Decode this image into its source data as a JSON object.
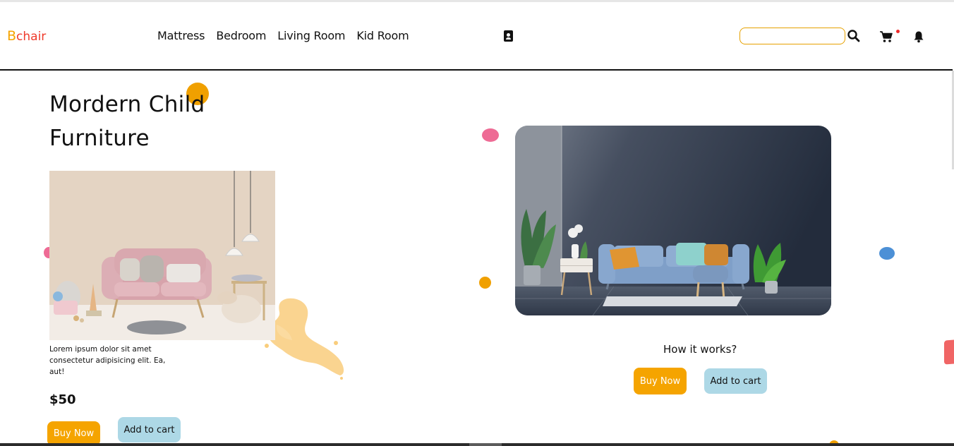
{
  "brand": {
    "first_letter": "B",
    "rest": "chair"
  },
  "nav": {
    "items": [
      {
        "label": "Mattress"
      },
      {
        "label": "Bedroom"
      },
      {
        "label": "Living Room"
      },
      {
        "label": "Kid Room"
      }
    ]
  },
  "header": {
    "search_value": "",
    "icons": [
      "contact-card-icon",
      "search-icon",
      "cart-icon",
      "bell-icon"
    ]
  },
  "left_section": {
    "title_line1": "Mordern Child",
    "title_line2": "Furniture",
    "description": "Lorem ipsum dolor sit amet consectetur adipisicing elit. Ea, aut!",
    "price": "$50",
    "buy_label": "Buy Now",
    "cart_label": "Add to cart"
  },
  "right_section": {
    "how_label": "How it works?",
    "buy_label": "Buy Now",
    "cart_label": "Add to cart"
  },
  "colors": {
    "accent_orange": "#f5a400",
    "accent_red": "#ef3b2c",
    "button_blue": "#add8e6",
    "dot_pink": "#ee6b95",
    "dot_blue": "#4c90d6"
  }
}
